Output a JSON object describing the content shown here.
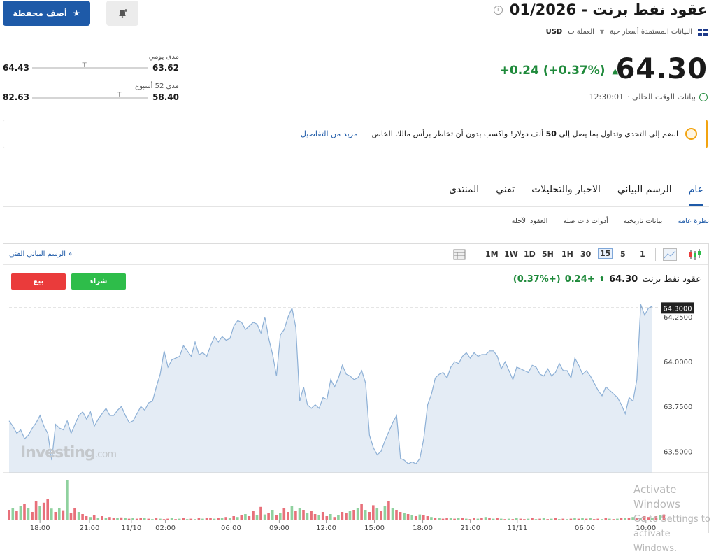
{
  "header": {
    "title": "عقود نفط برنت - 01/2026",
    "info_icon": "i",
    "data_source": "البيانات المستمدة أسعار حية",
    "currency_label": "العملة ب",
    "currency": "USD",
    "add_portfolio": "أضف محفظة",
    "price": "64.30",
    "change": "+0.24 (+0.37%)",
    "time_label": "بيانات الوقت الحالي ·",
    "time": "12:30:01"
  },
  "ranges": {
    "daily": {
      "label": "مدى يومي",
      "low": "63.62",
      "high": "64.43",
      "position": 0.55
    },
    "week52": {
      "label": "مدى 52 أسبوع",
      "low": "58.40",
      "high": "82.63",
      "position": 0.25
    }
  },
  "promo": {
    "text_before": "انضم إلى التحدي وتداول بما يصل إلى ",
    "bold": "50",
    "text_after": " ألف دولار! واكسب بدون أن تخاطر برأس مالك الخاص",
    "link": "مزيد من التفاصيل"
  },
  "tabs": [
    "عام",
    "الرسم البياني",
    "الاخبار والتحليلات",
    "تقني",
    "المنتدى"
  ],
  "subtabs": [
    "نظرة عامة",
    "بيانات تاريخية",
    "أدوات ذات صلة",
    "العقود الآجلة"
  ],
  "toolbar": {
    "timeframes": [
      "1",
      "5",
      "15",
      "30",
      "1H",
      "5H",
      "1D",
      "1W",
      "1M"
    ],
    "selected": "15",
    "full_chart_link": "الرسم البياني الفني »"
  },
  "trade": {
    "sell": "بيع",
    "buy": "شراء"
  },
  "chart_header": {
    "name": "عقود نفط برنت",
    "price": "64.30",
    "change": "+0.24",
    "pct": "(+0.37%)"
  },
  "watermark": {
    "brand": "Investing",
    "suffix": ".com"
  },
  "os_watermark": {
    "line1": "Activate Windows",
    "line2": "Go to Settings to activate Windows."
  },
  "colors": {
    "up": "#1f8a3b",
    "down": "#ea3b3b",
    "accent": "#1e5aa8",
    "area": "#e4ecf5",
    "line": "#8db0d6"
  },
  "chart_data": {
    "type": "area",
    "ylim": [
      63.38,
      64.36
    ],
    "y_ticks": [
      "64.2500",
      "64.0000",
      "63.7500",
      "63.5000"
    ],
    "y_tick_values": [
      64.25,
      64.0,
      63.75,
      63.5
    ],
    "last_price_label": "64.3000",
    "last_price": 64.3,
    "x_ticks": [
      "18:00",
      "21:00",
      "11/10",
      "02:00",
      "06:00",
      "09:00",
      "12:00",
      "15:00",
      "18:00",
      "21:00",
      "11/11",
      "06:00",
      "10:00"
    ],
    "values": [
      63.67,
      63.64,
      63.6,
      63.62,
      63.57,
      63.59,
      63.63,
      63.66,
      63.7,
      63.64,
      63.6,
      63.45,
      63.65,
      63.63,
      63.62,
      63.67,
      63.6,
      63.65,
      63.7,
      63.72,
      63.68,
      63.72,
      63.64,
      63.68,
      63.71,
      63.74,
      63.7,
      63.7,
      63.73,
      63.75,
      63.7,
      63.66,
      63.67,
      63.71,
      63.75,
      63.73,
      63.77,
      63.78,
      63.86,
      63.93,
      64.06,
      63.97,
      64.01,
      64.02,
      64.03,
      64.09,
      64.06,
      64.03,
      64.11,
      64.04,
      64.05,
      64.03,
      64.09,
      64.14,
      64.11,
      64.14,
      64.12,
      64.13,
      64.2,
      64.23,
      64.22,
      64.18,
      64.2,
      64.22,
      64.21,
      64.16,
      64.25,
      64.13,
      64.04,
      63.92,
      64.15,
      64.18,
      64.25,
      64.3,
      64.19,
      63.78,
      63.86,
      63.76,
      63.74,
      63.76,
      63.74,
      63.8,
      63.79,
      63.9,
      63.86,
      63.91,
      63.98,
      63.93,
      63.92,
      63.9,
      63.91,
      63.95,
      63.88,
      63.59,
      63.52,
      63.48,
      63.5,
      63.56,
      63.61,
      63.66,
      63.7,
      63.46,
      63.45,
      63.43,
      63.44,
      63.43,
      63.46,
      63.57,
      63.76,
      63.82,
      63.91,
      63.93,
      63.94,
      63.91,
      63.97,
      64.0,
      63.99,
      64.03,
      64.05,
      64.02,
      64.05,
      64.03,
      64.04,
      64.04,
      64.06,
      64.06,
      64.03,
      63.96,
      64.0,
      63.95,
      63.9,
      63.97,
      63.96,
      63.95,
      63.94,
      63.98,
      63.97,
      63.93,
      63.92,
      63.96,
      63.92,
      63.94,
      63.99,
      63.95,
      63.95,
      63.91,
      64.02,
      63.98,
      63.93,
      63.95,
      63.92,
      63.88,
      63.84,
      63.81,
      63.86,
      63.84,
      63.82,
      63.8,
      63.76,
      63.71,
      63.8,
      63.78,
      63.9,
      64.32,
      64.26,
      64.3,
      64.31
    ],
    "volumes": [
      0.25,
      0.3,
      0.22,
      0.35,
      0.4,
      0.3,
      0.2,
      0.45,
      0.35,
      0.42,
      0.5,
      0.28,
      0.2,
      0.3,
      0.24,
      0.95,
      0.18,
      0.3,
      0.2,
      0.15,
      0.1,
      0.08,
      0.12,
      0.06,
      0.1,
      0.05,
      0.08,
      0.06,
      0.05,
      0.07,
      0.05,
      0.04,
      0.05,
      0.04,
      0.06,
      0.05,
      0.04,
      0.03,
      0.05,
      0.04,
      0.03,
      0.04,
      0.05,
      0.03,
      0.04,
      0.05,
      0.03,
      0.04,
      0.03,
      0.05,
      0.04,
      0.05,
      0.06,
      0.04,
      0.05,
      0.06,
      0.08,
      0.06,
      0.1,
      0.08,
      0.12,
      0.15,
      0.1,
      0.22,
      0.12,
      0.32,
      0.14,
      0.18,
      0.25,
      0.12,
      0.18,
      0.3,
      0.2,
      0.35,
      0.22,
      0.3,
      0.25,
      0.18,
      0.22,
      0.15,
      0.12,
      0.2,
      0.1,
      0.15,
      0.08,
      0.12,
      0.2,
      0.18,
      0.22,
      0.25,
      0.3,
      0.4,
      0.25,
      0.2,
      0.36,
      0.3,
      0.22,
      0.35,
      0.45,
      0.3,
      0.25,
      0.2,
      0.18,
      0.15,
      0.12,
      0.1,
      0.14,
      0.12,
      0.1,
      0.08,
      0.06,
      0.05,
      0.04,
      0.06,
      0.05,
      0.04,
      0.06,
      0.05,
      0.04,
      0.03,
      0.05,
      0.04,
      0.06,
      0.08,
      0.05,
      0.04,
      0.05,
      0.04,
      0.03,
      0.04,
      0.03,
      0.05,
      0.04,
      0.03,
      0.04,
      0.05,
      0.03,
      0.04,
      0.05,
      0.03,
      0.04,
      0.05,
      0.03,
      0.04,
      0.03,
      0.04,
      0.05,
      0.04,
      0.05,
      0.04,
      0.05,
      0.03,
      0.04,
      0.03,
      0.05,
      0.04,
      0.03,
      0.04,
      0.05,
      0.06,
      0.05,
      0.08,
      0.06,
      0.05,
      0.1,
      0.08,
      0.06,
      0.1,
      0.12,
      0.14
    ],
    "volume_up": [
      false,
      true,
      false,
      true,
      false,
      true,
      false,
      false,
      true,
      false,
      false,
      true,
      false,
      true,
      false,
      true,
      false,
      false,
      true,
      false,
      false,
      true,
      false,
      true,
      false,
      true,
      false,
      false,
      true,
      false,
      true,
      false,
      true,
      false,
      false,
      true,
      false,
      true,
      false,
      true,
      false,
      false,
      true,
      false,
      true,
      false,
      true,
      false,
      true,
      false,
      true,
      false,
      false,
      true,
      false,
      true,
      false,
      true,
      false,
      true,
      false,
      true,
      false,
      false,
      true,
      false,
      true,
      false,
      true,
      false,
      true,
      false,
      false,
      true,
      false,
      true,
      false,
      true,
      false,
      false,
      true,
      false,
      false,
      true,
      false,
      true,
      false,
      false,
      true,
      false,
      true,
      false,
      true,
      false,
      false,
      true,
      false,
      true,
      false,
      true,
      false,
      false,
      true,
      false,
      true,
      false,
      true,
      false,
      false,
      true,
      false,
      true,
      false,
      false,
      true,
      false,
      true,
      false,
      true,
      false,
      false,
      true,
      false,
      true,
      false,
      true,
      false,
      true,
      false,
      true,
      false,
      true,
      false,
      false,
      true,
      false,
      true,
      false,
      true,
      false,
      true,
      false,
      true,
      false,
      true,
      false,
      true,
      false,
      true,
      false,
      true,
      false,
      false,
      true,
      false,
      true,
      false,
      true,
      false,
      true,
      false,
      true,
      false,
      true,
      false
    ]
  }
}
